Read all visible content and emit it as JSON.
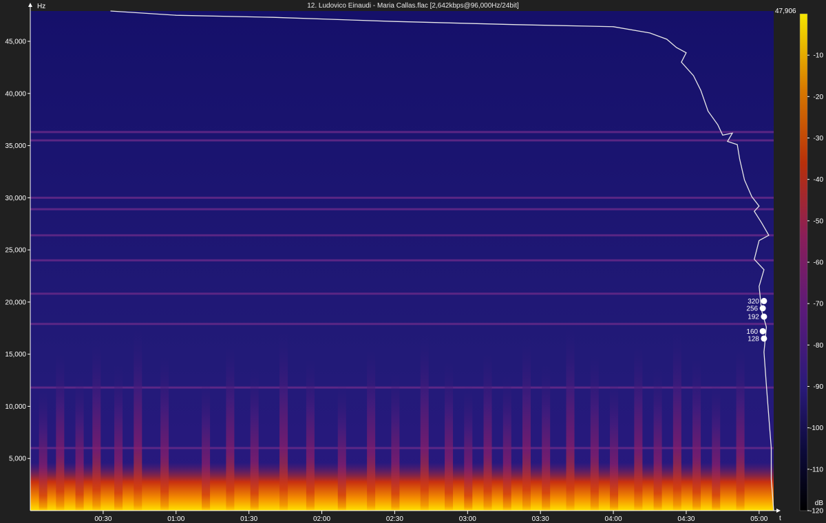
{
  "window": {
    "title": "12. Ludovico Einaudi - Maria Callas.flac [2,642kbps@96,000Hz/24bit]"
  },
  "chart_data": {
    "type": "heatmap",
    "title": "12. Ludovico Einaudi - Maria Callas.flac [2,642kbps@96,000Hz/24bit]",
    "xlabel": "t",
    "ylabel": "Hz",
    "colorbar_label": "dB",
    "xlim_seconds": [
      0,
      306
    ],
    "ylim": [
      0,
      47906
    ],
    "y_max_label": "47,906",
    "x_ticks": [
      "00:30",
      "01:00",
      "01:30",
      "02:00",
      "02:30",
      "03:00",
      "03:30",
      "04:00",
      "04:30",
      "05:00"
    ],
    "x_tick_seconds": [
      30,
      60,
      90,
      120,
      150,
      180,
      210,
      240,
      270,
      300
    ],
    "y_ticks": [
      "5,000",
      "10,000",
      "15,000",
      "20,000",
      "25,000",
      "30,000",
      "35,000",
      "40,000",
      "45,000"
    ],
    "y_tick_values": [
      5000,
      10000,
      15000,
      20000,
      25000,
      30000,
      35000,
      40000,
      45000
    ],
    "colorbar_ticks": [
      "-10",
      "-20",
      "-30",
      "-40",
      "-50",
      "-60",
      "-70",
      "-80",
      "-90",
      "-100",
      "-110",
      "-120"
    ],
    "colorbar_values": [
      -10,
      -20,
      -30,
      -40,
      -50,
      -60,
      -70,
      -80,
      -90,
      -100,
      -110,
      -120
    ],
    "colorbar_range": [
      -120,
      0
    ],
    "colors": {
      "background": "#1b1464",
      "low": "#000000",
      "mid": "#8a1e6e",
      "high": "#d94a00",
      "top": "#f5e600"
    },
    "horizontal_bands_hz": [
      6000,
      11800,
      17900,
      20800,
      24000,
      26400,
      28900,
      30000,
      35500,
      36300
    ],
    "bitrate_markers": [
      {
        "label": "320",
        "freq": 20100
      },
      {
        "label": "256",
        "freq": 19400
      },
      {
        "label": "192",
        "freq": 18600
      },
      {
        "label": "160",
        "freq": 17200
      },
      {
        "label": "128",
        "freq": 16500
      }
    ]
  }
}
